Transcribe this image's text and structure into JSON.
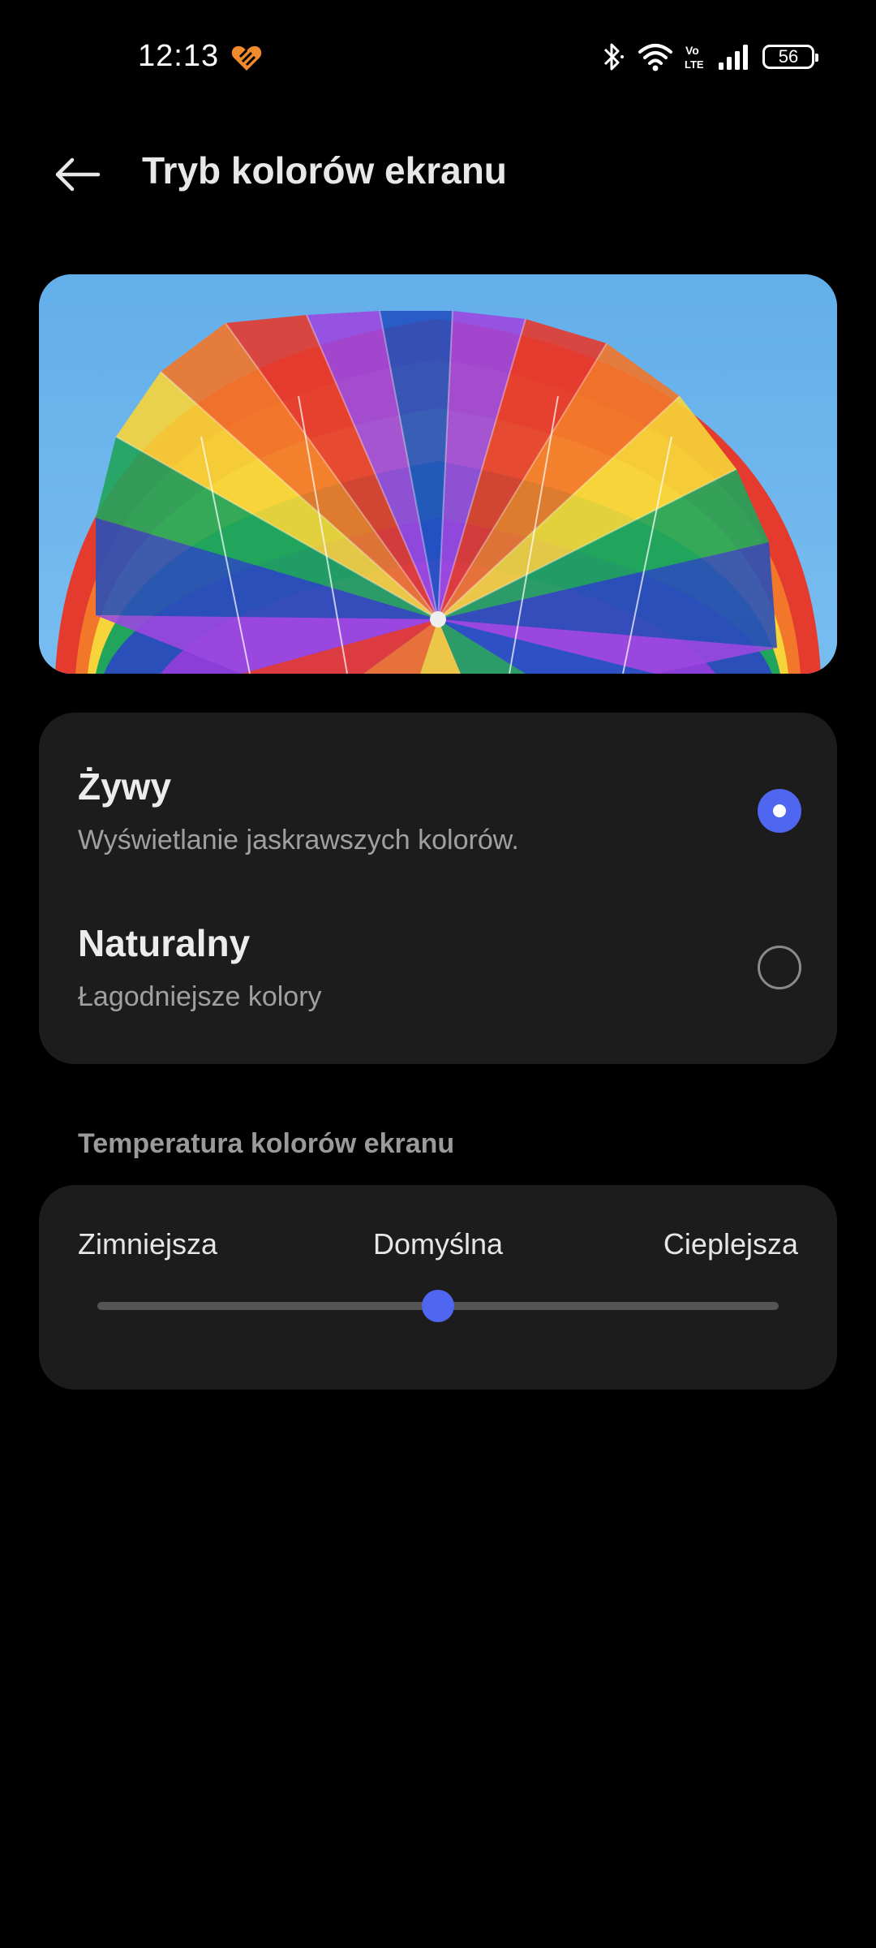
{
  "status_bar": {
    "time": "12:13",
    "battery_level": "56",
    "network_label_top": "Vo",
    "network_label_bottom": "LTE",
    "icons": [
      "app-heart-icon",
      "bluetooth-icon",
      "wifi-icon",
      "volte-icon",
      "signal-icon",
      "battery-icon"
    ]
  },
  "header": {
    "title": "Tryb kolorów ekranu",
    "back_icon": "arrow-left-icon"
  },
  "color_modes": {
    "options": [
      {
        "title": "Żywy",
        "description": "Wyświetlanie jaskrawszych kolorów.",
        "selected": true
      },
      {
        "title": "Naturalny",
        "description": "Łagodniejsze kolory",
        "selected": false
      }
    ]
  },
  "temperature": {
    "section_label": "Temperatura kolorów ekranu",
    "left_label": "Zimniejsza",
    "center_label": "Domyślna",
    "right_label": "Cieplejsza",
    "slider_value": 0.5
  },
  "colors": {
    "background": "#000000",
    "card": "#1c1c1c",
    "accent": "#4f66f0",
    "app_icon": "#f08a2c"
  }
}
